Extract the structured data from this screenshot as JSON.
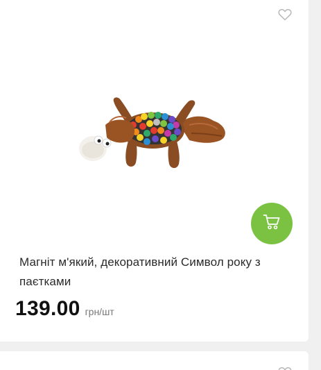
{
  "product": {
    "title": "Магніт м'який, декоративний Символ року з паєтками",
    "price": "139.00",
    "unit": "грн/шт",
    "image_name": "plush-sequin-ox-magnet"
  },
  "icons": {
    "favorite": "heart-outline-icon",
    "cart": "cart-icon"
  },
  "colors": {
    "cart_button": "#7cc242",
    "background": "#f0f0f0",
    "card": "#ffffff"
  }
}
